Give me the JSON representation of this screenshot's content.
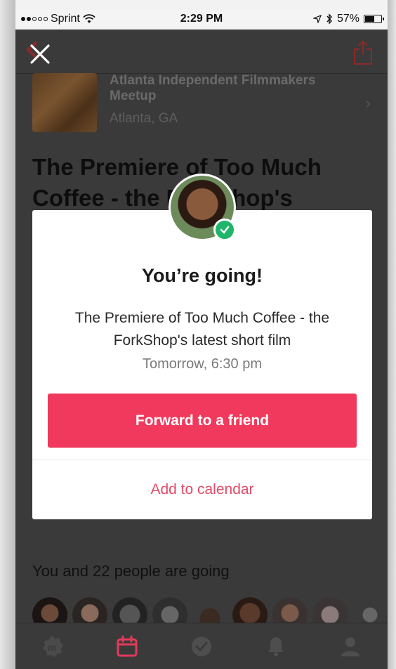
{
  "status_bar": {
    "carrier": "Sprint",
    "time": "2:29 PM",
    "battery": "57%",
    "battery_level": 0.57,
    "signal_bars_filled": 2
  },
  "group": {
    "name": "Atlanta Independent Filmmakers Meetup",
    "location": "Atlanta, GA"
  },
  "event": {
    "title": "The Premiere of Too Much Coffee - the ForkShop's"
  },
  "modal": {
    "heading": "You’re going!",
    "event_name": "The Premiere of Too Much Coffee - the ForkShop's latest short film",
    "time": "Tomorrow, 6:30 pm",
    "forward_label": "Forward to a friend",
    "calendar_label": "Add to calendar"
  },
  "attendees": {
    "label": "You and 22 people are going"
  },
  "colors": {
    "accent": "#f0395c",
    "link": "#e34a68",
    "check": "#1fb56b",
    "calendar_tab": "#e33a5a"
  },
  "tabs": [
    {
      "icon": "meetup-logo-icon"
    },
    {
      "icon": "calendar-icon"
    },
    {
      "icon": "check-circle-icon"
    },
    {
      "icon": "bell-icon"
    },
    {
      "icon": "person-icon"
    }
  ]
}
